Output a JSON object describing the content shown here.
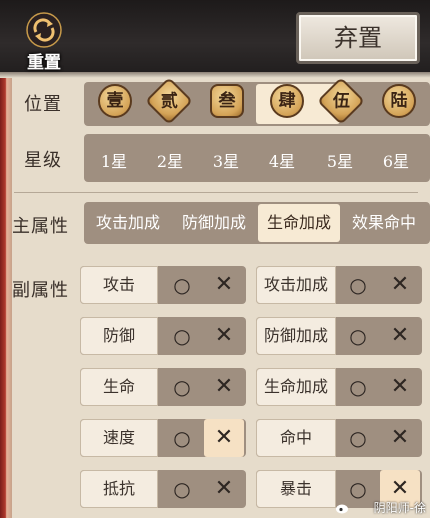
{
  "header": {
    "reset_label": "重置",
    "discard_label": "弃置"
  },
  "position": {
    "label": "位置",
    "items": [
      "壹",
      "贰",
      "叁",
      "肆",
      "伍",
      "陆"
    ],
    "selected": "肆"
  },
  "star_level": {
    "label": "星级",
    "items": [
      "1星",
      "2星",
      "3星",
      "4星",
      "5星",
      "6星"
    ]
  },
  "main_attr": {
    "label": "主属性",
    "items": [
      "攻击加成",
      "防御加成",
      "生命加成",
      "效果命中"
    ],
    "selected": "生命加成"
  },
  "sub_attr": {
    "label": "副属性",
    "rows": [
      {
        "left": "攻击",
        "right": "攻击加成"
      },
      {
        "left": "防御",
        "right": "防御加成"
      },
      {
        "left": "生命",
        "right": "生命加成"
      },
      {
        "left": "速度",
        "right": "命中"
      },
      {
        "left": "抵抗",
        "right": "暴击"
      }
    ],
    "circle_symbol": "○",
    "cross_symbol": "✕",
    "active_cross": [
      "速度",
      "暴击"
    ]
  },
  "watermark": "阴阳师-徐",
  "colors": {
    "panel_bg": "#e6dccb",
    "strip_bg": "#9f8f80",
    "selected_bg": "#f7ead4",
    "topbar_bg": "#2a2626"
  }
}
